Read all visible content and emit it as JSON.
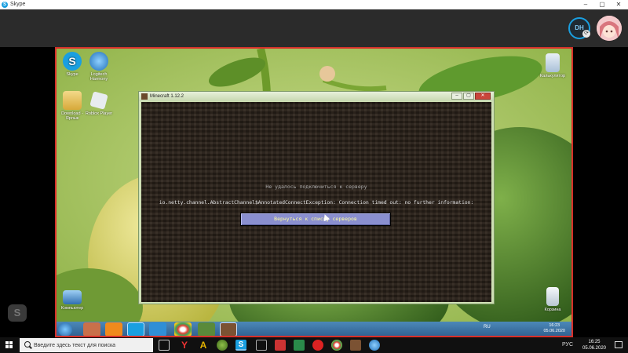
{
  "skype": {
    "title": "Skype",
    "window_controls": {
      "minimize": "–",
      "maximize": "▢",
      "close": "✕"
    },
    "user_initials": "DH",
    "badge_icon": "⟳"
  },
  "remote": {
    "desktop_icons": [
      {
        "label": "Skype",
        "icon": "skype-icon",
        "color": "#1a9fe0"
      },
      {
        "label": "Logitech Harmony",
        "icon": "harmony-icon",
        "color": "#2f8fd6"
      },
      {
        "label": "Download - Ярлык",
        "icon": "folder-icon",
        "color": "#e8c35a"
      },
      {
        "label": "Roblox Player",
        "icon": "roblox-icon",
        "color": "#dfe3e8"
      },
      {
        "label": "Калькулятор",
        "icon": "calculator-icon",
        "color": "#c7d7e8"
      },
      {
        "label": "Компьютер",
        "icon": "computer-icon",
        "color": "#5fa0d8"
      },
      {
        "label": "Корзина",
        "icon": "recycle-bin-icon",
        "color": "#dfe8ef"
      }
    ],
    "minecraft": {
      "title": "Minecraft 1.12.2",
      "error_title": "Не удалось подключиться к серверу",
      "error_message": "io.netty.channel.AbstractChannel$AnnotatedConnectException: Connection timed out: no further information:",
      "back_button": "Вернуться к списку серверов"
    },
    "taskbar": {
      "language": "RU",
      "time": "16:23",
      "date": "05.06.2020"
    }
  },
  "host_taskbar": {
    "search_placeholder": "Введите здесь текст для поиска",
    "language": "РУС",
    "time": "16:25",
    "date": "05.06.2020"
  }
}
